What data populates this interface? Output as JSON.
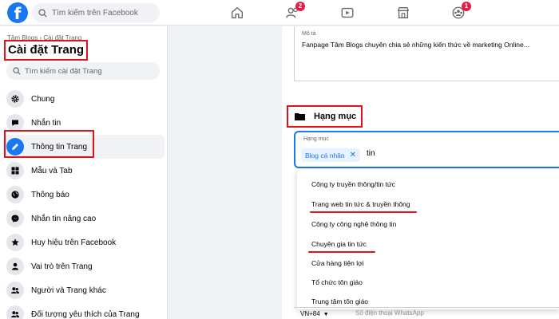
{
  "topbar": {
    "logo_letter": "f",
    "search_placeholder": "Tìm kiếm trên Facebook",
    "nav": [
      {
        "icon": "home-icon",
        "badge": ""
      },
      {
        "icon": "friends-icon",
        "badge": "2"
      },
      {
        "icon": "watch-icon",
        "badge": ""
      },
      {
        "icon": "marketplace-icon",
        "badge": ""
      },
      {
        "icon": "groups-icon",
        "badge": "1"
      }
    ]
  },
  "sidebar": {
    "breadcrumb": "Tâm Blogs › Cài đặt Trang",
    "title": "Cài đặt Trang",
    "search_placeholder": "Tìm kiếm cài đặt Trang",
    "items": [
      {
        "label": "Chung",
        "icon": "gear-icon"
      },
      {
        "label": "Nhắn tin",
        "icon": "messages-icon"
      },
      {
        "label": "Thông tin Trang",
        "icon": "pencil-icon"
      },
      {
        "label": "Mẫu và Tab",
        "icon": "grid-icon"
      },
      {
        "label": "Thông báo",
        "icon": "globe-icon"
      },
      {
        "label": "Nhắn tin nâng cao",
        "icon": "messenger-icon"
      },
      {
        "label": "Huy hiệu trên Facebook",
        "icon": "star-icon"
      },
      {
        "label": "Vai trò trên Trang",
        "icon": "person-icon"
      },
      {
        "label": "Người và Trang khác",
        "icon": "people-icon"
      },
      {
        "label": "Đối tượng yêu thích của Trang",
        "icon": "people-icon"
      }
    ]
  },
  "main": {
    "description": {
      "label": "Mô tả",
      "text": "Fanpage Tâm Blogs chuyên chia sẻ những kiến thức về marketing Online..."
    },
    "category": {
      "title": "Hạng mục",
      "field_label": "Hạng mục",
      "chip": "Blog cá nhân",
      "input_value": "tin"
    },
    "dropdown": [
      "Công ty truyền thông/tin tức",
      "Trang web tin tức & truyền thông",
      "Công ty công nghệ thông tin",
      "Chuyên gia tin tức",
      "Cửa hàng tiện lợi",
      "Tổ chức tôn giáo",
      "Trung tâm tôn giáo"
    ],
    "phone": {
      "country": "VN+84",
      "placeholder": "Số điện thoại WhatsApp"
    }
  },
  "colors": {
    "brand": "#1877f2",
    "highlight": "#e4101a",
    "badge": "#e41e3f"
  }
}
